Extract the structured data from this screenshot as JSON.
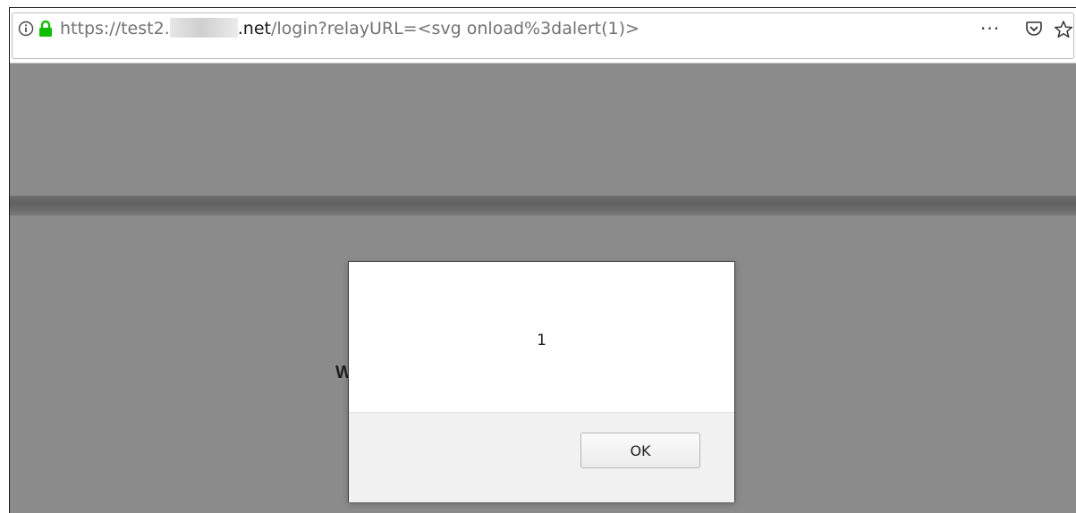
{
  "browser": {
    "url_scheme": "https://",
    "url_host_start": "test2.",
    "url_host_end": ".net",
    "url_path": "/login?relayURL=<svg onload%3dalert(1)>",
    "more_label": "···",
    "icons": [
      "info-icon",
      "lock-icon",
      "more-icon",
      "pocket-icon",
      "star-icon"
    ]
  },
  "page": {
    "partial_text": "W"
  },
  "alert": {
    "message": "1",
    "ok_label": "OK"
  },
  "colors": {
    "lock": "#12bc00",
    "overlay": "#8b8b8b"
  }
}
